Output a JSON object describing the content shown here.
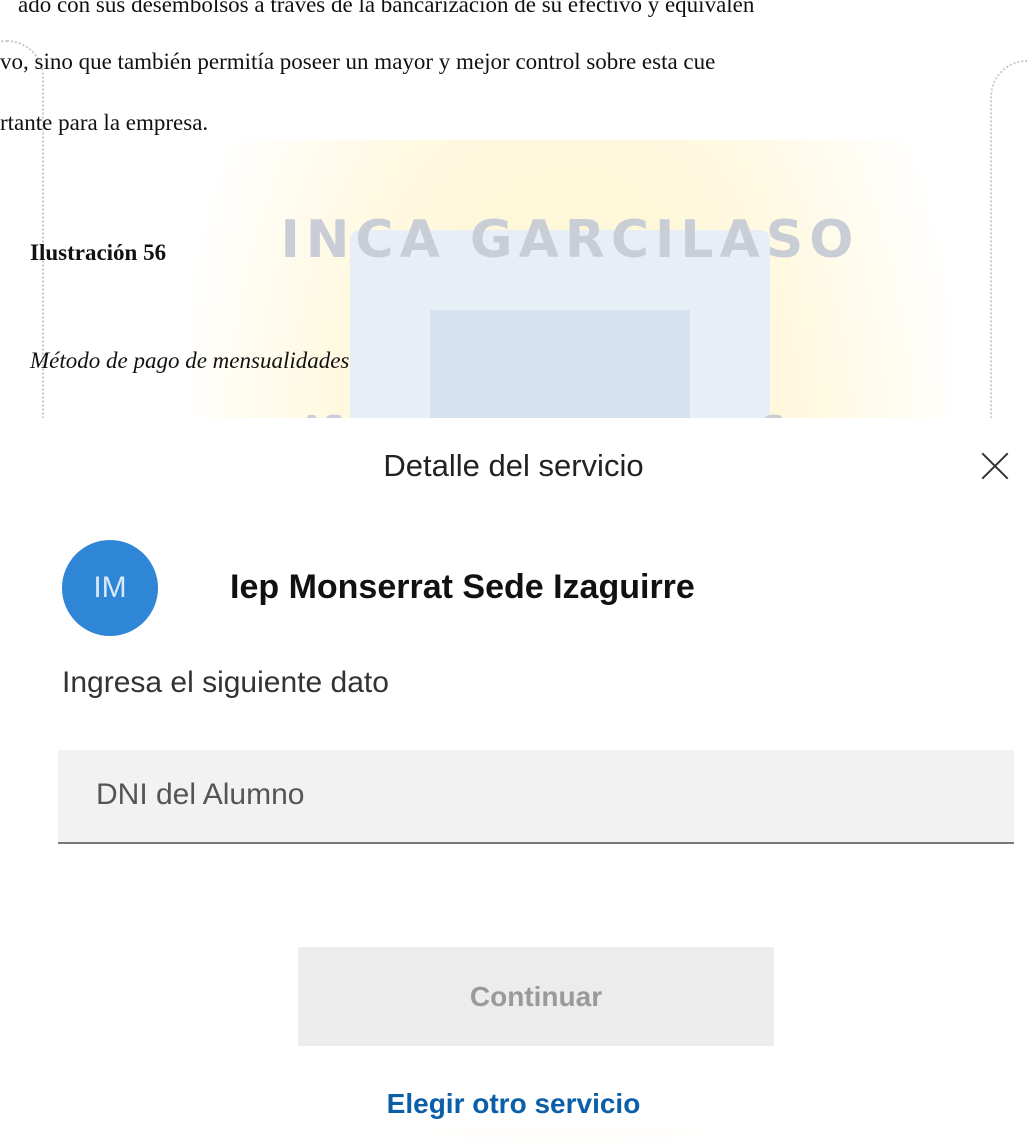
{
  "document": {
    "lines": [
      "ado con sus desembolsos a través de la bancarización de su efectivo y equivalen",
      "vo, sino que también permitía poseer un mayor y mejor control sobre esta cue",
      "rtante para la empresa."
    ],
    "figure_number": "Ilustración 56",
    "figure_title": "Método de pago de mensualidades"
  },
  "watermark": {
    "text": "INCA GARCILASO",
    "side_left": "AS",
    "side_right": "G"
  },
  "dialog": {
    "title": "Detalle del servicio",
    "close_icon": "close-icon",
    "avatar_initials": "IM",
    "avatar_color": "#2f86d6",
    "merchant_name": "Iep Monserrat Sede Izaguirre",
    "prompt": "Ingresa el siguiente dato",
    "field_placeholder": "DNI del Alumno",
    "continue_label": "Continuar",
    "other_service_label": "Elegir otro servicio",
    "link_color": "#0b5ea8"
  }
}
